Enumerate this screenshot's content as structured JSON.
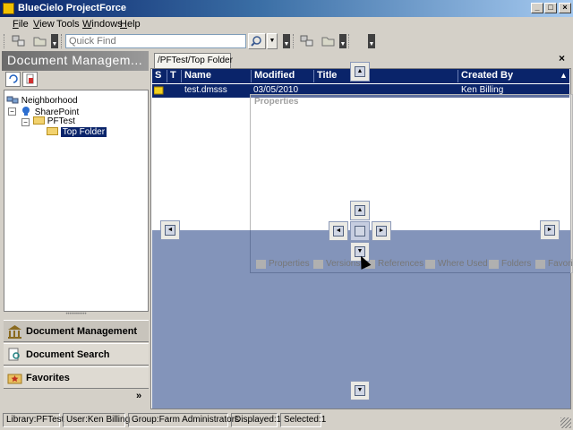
{
  "window": {
    "title": "BlueCielo ProjectForce",
    "controls": {
      "minimize": "_",
      "maximize": "□",
      "close": "×"
    }
  },
  "menu": {
    "items": [
      {
        "label": "File",
        "accel": "F",
        "rest": "ile"
      },
      {
        "label": "View",
        "accel": "V",
        "rest": "iew"
      },
      {
        "label": "Tools",
        "accel": "",
        "rest": "Tools"
      },
      {
        "label": "Windows",
        "accel": "W",
        "rest": "indows"
      },
      {
        "label": "Help",
        "accel": "H",
        "rest": "elp"
      }
    ]
  },
  "toolbar": {
    "search": {
      "placeholder": "Quick Find",
      "value": ""
    }
  },
  "left_panel": {
    "header": "Document Managem...",
    "tree": [
      {
        "label": "Neighborhood",
        "icon": "network-icon"
      },
      {
        "label": "SharePoint",
        "icon": "server-icon"
      },
      {
        "label": "PFTest",
        "icon": "folder-icon"
      },
      {
        "label": "Top Folder",
        "icon": "folder-open-icon",
        "selected": true
      }
    ],
    "nav": [
      {
        "label": "Document Management",
        "icon": "building-icon",
        "active": true
      },
      {
        "label": "Document Search",
        "icon": "search-doc-icon",
        "active": false
      },
      {
        "label": "Favorites",
        "icon": "star-folder-icon",
        "active": false
      }
    ],
    "more_chevron": "»"
  },
  "document": {
    "tab_label": "/PFTest/Top Folder",
    "close_label": "×",
    "columns": [
      "S",
      "T",
      "Name",
      "Modified",
      "Title",
      "Created By"
    ],
    "sort_indicator": "▲",
    "rows": [
      {
        "name": "test.dmsss",
        "modified": "03/05/2010",
        "title": "",
        "created_by": "Ken Billing"
      }
    ]
  },
  "properties_panel": {
    "title": "Properties",
    "tabs": [
      "Properties",
      "Versions",
      "References",
      "Where Used",
      "Folders",
      "Favorit"
    ]
  },
  "status_bar": {
    "library": "Library:PFTest",
    "user": "User:Ken Billing",
    "group": "Group:Farm  Administrators",
    "displayed": "Displayed:1",
    "selected": "Selected:1"
  },
  "colors": {
    "header_blue": "#0a246a",
    "selection_blue": "#0a246a",
    "dock_overlay": "#1e3c82"
  }
}
